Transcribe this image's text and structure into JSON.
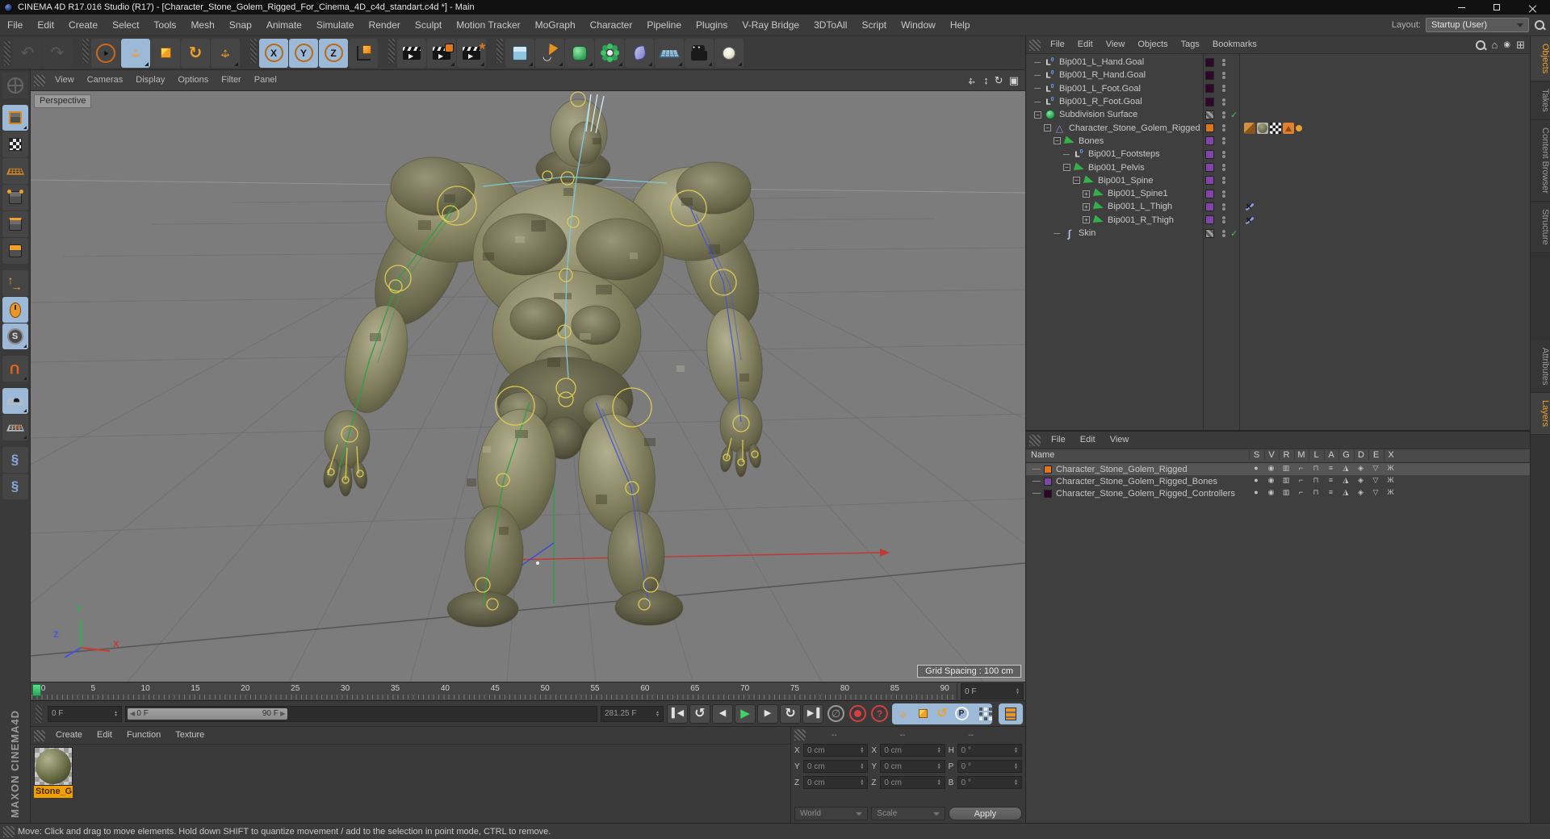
{
  "window": {
    "title": "CINEMA 4D R17.016 Studio (R17) - [Character_Stone_Golem_Rigged_For_Cinema_4D_c4d_standart.c4d *] - Main"
  },
  "menubar": [
    "File",
    "Edit",
    "Create",
    "Select",
    "Tools",
    "Mesh",
    "Snap",
    "Animate",
    "Simulate",
    "Render",
    "Sculpt",
    "Motion Tracker",
    "MoGraph",
    "Character",
    "Pipeline",
    "Plugins",
    "V-Ray Bridge",
    "3DToAll",
    "Script",
    "Window",
    "Help"
  ],
  "layout": {
    "label": "Layout:",
    "value": "Startup (User)"
  },
  "toolbar": {
    "groups": [
      {
        "buttons": [
          {
            "name": "undo",
            "disabled": true
          },
          {
            "name": "redo",
            "disabled": true
          }
        ]
      },
      {
        "buttons": [
          {
            "name": "live-selection"
          },
          {
            "name": "move",
            "active": true,
            "flyout": true
          },
          {
            "name": "scale"
          },
          {
            "name": "rotate"
          },
          {
            "name": "last-tool-move",
            "flyout": true
          }
        ]
      },
      {
        "buttons": [
          {
            "name": "lock-x",
            "letter": "X",
            "active": true
          },
          {
            "name": "lock-y",
            "letter": "Y",
            "active": true
          },
          {
            "name": "lock-z",
            "letter": "Z",
            "active": true
          },
          {
            "name": "coordinate-system"
          }
        ]
      },
      {
        "buttons": [
          {
            "name": "render-view"
          },
          {
            "name": "render-picture-viewer",
            "flyout": true
          },
          {
            "name": "render-settings",
            "flyout": true
          }
        ]
      },
      {
        "buttons": [
          {
            "name": "add-cube",
            "flyout": true
          },
          {
            "name": "add-spline",
            "flyout": true
          },
          {
            "name": "add-subdivision-surface",
            "flyout": true
          },
          {
            "name": "add-mograph",
            "flyout": true
          },
          {
            "name": "add-deformer",
            "flyout": true
          },
          {
            "name": "add-environment",
            "flyout": true
          },
          {
            "name": "add-camera",
            "flyout": true
          },
          {
            "name": "add-light",
            "flyout": true
          }
        ]
      }
    ]
  },
  "left_palette": [
    {
      "name": "make-editable",
      "disabled": true
    },
    {
      "name": "model-mode",
      "active": true,
      "flyout": true
    },
    {
      "name": "texture-mode"
    },
    {
      "name": "workplane-mode"
    },
    {
      "name": "points-mode"
    },
    {
      "name": "edges-mode"
    },
    {
      "name": "polygons-mode"
    },
    {
      "name": "enable-axis"
    },
    {
      "name": "viewport-mouse",
      "active": true
    },
    {
      "name": "viewport-solo",
      "active": true,
      "flyout": true
    },
    {
      "name": "enable-snap",
      "flyout": true
    },
    {
      "name": "workplane-lock",
      "active": true,
      "flyout": true
    },
    {
      "name": "workplane-interactive",
      "flyout": true
    },
    {
      "name": "script-python-1"
    },
    {
      "name": "script-python-2"
    }
  ],
  "viewport": {
    "menu": [
      "View",
      "Cameras",
      "Display",
      "Options",
      "Filter",
      "Panel"
    ],
    "view_label": "Perspective",
    "grid_spacing": "Grid Spacing : 100 cm",
    "axis_labels": {
      "x": "X",
      "y": "Y",
      "z": "Z"
    }
  },
  "object_manager": {
    "menu": [
      "File",
      "Edit",
      "View",
      "Objects",
      "Tags",
      "Bookmarks"
    ],
    "items": [
      {
        "label": "Bip001_L_Hand.Goal",
        "icon": "null-object-icon",
        "indent": 0,
        "expand": "none",
        "chip": "#30062b",
        "dots": true
      },
      {
        "label": "Bip001_R_Hand.Goal",
        "icon": "null-object-icon",
        "indent": 0,
        "expand": "none",
        "chip": "#30062b",
        "dots": true
      },
      {
        "label": "Bip001_L_Foot.Goal",
        "icon": "null-object-icon",
        "indent": 0,
        "expand": "none",
        "chip": "#30062b",
        "dots": true
      },
      {
        "label": "Bip001_R_Foot.Goal",
        "icon": "null-object-icon",
        "indent": 0,
        "expand": "none",
        "chip": "#30062b",
        "dots": true
      },
      {
        "label": "Subdivision Surface",
        "icon": "subdivision-surface-icon",
        "indent": 0,
        "expand": "minus",
        "chip": "striped",
        "dots": true,
        "check": true
      },
      {
        "label": "Character_Stone_Golem_Rigged",
        "icon": "polygon-object-icon",
        "indent": 1,
        "expand": "minus",
        "chip": "#e0761c",
        "dots": true,
        "tags": [
          "weight-tag",
          "texture-tag",
          "uvw-tag",
          "phong-tag",
          "display-dot-tag"
        ]
      },
      {
        "label": "Bones",
        "icon": "joint-icon",
        "indent": 2,
        "expand": "minus",
        "chip": "#8045aa",
        "dots": true
      },
      {
        "label": "Bip001_Footsteps",
        "icon": "null-object-icon",
        "indent": 3,
        "expand": "none",
        "chip": "#8045aa",
        "dots": true
      },
      {
        "label": "Bip001_Pelvis",
        "icon": "joint-icon",
        "indent": 3,
        "expand": "minus",
        "chip": "#8045aa",
        "dots": true
      },
      {
        "label": "Bip001_Spine",
        "icon": "joint-icon",
        "indent": 4,
        "expand": "minus",
        "chip": "#8045aa",
        "dots": true
      },
      {
        "label": "Bip001_Spine1",
        "icon": "joint-icon",
        "indent": 5,
        "expand": "plus",
        "chip": "#8045aa",
        "dots": true
      },
      {
        "label": "Bip001_L_Thigh",
        "icon": "joint-icon",
        "indent": 5,
        "expand": "plus",
        "chip": "#8045aa",
        "dots": true,
        "tags": [
          "ik-tag"
        ]
      },
      {
        "label": "Bip001_R_Thigh",
        "icon": "joint-icon",
        "indent": 5,
        "expand": "plus",
        "chip": "#8045aa",
        "dots": true,
        "tags": [
          "ik-tag"
        ]
      },
      {
        "label": "Skin",
        "icon": "skin-icon",
        "indent": 2,
        "expand": "none",
        "chip": "striped",
        "dots": true,
        "check": true
      }
    ]
  },
  "right_tabs": {
    "top": [
      {
        "label": "Objects",
        "active": true
      },
      {
        "label": "Takes",
        "active": false
      },
      {
        "label": "Content Browser",
        "active": false
      },
      {
        "label": "Structure",
        "active": false
      }
    ],
    "bottom": [
      {
        "label": "Attributes",
        "active": false
      },
      {
        "label": "Layers",
        "active": true
      }
    ]
  },
  "layers_panel": {
    "menu": [
      "File",
      "Edit",
      "View"
    ],
    "name_column": "Name",
    "columns": [
      "S",
      "V",
      "R",
      "M",
      "L",
      "A",
      "G",
      "D",
      "E",
      "X"
    ],
    "rows": [
      {
        "name": "Character_Stone_Golem_Rigged",
        "color": "#e0761c",
        "selected": true
      },
      {
        "name": "Character_Stone_Golem_Rigged_Bones",
        "color": "#8045aa",
        "selected": false
      },
      {
        "name": "Character_Stone_Golem_Rigged_Controllers",
        "color": "#30062b",
        "selected": false
      }
    ]
  },
  "timeline": {
    "ticks": [
      "0",
      "5",
      "10",
      "15",
      "20",
      "25",
      "30",
      "35",
      "40",
      "45",
      "50",
      "55",
      "60",
      "65",
      "70",
      "75",
      "80",
      "85",
      "90"
    ],
    "frame_field": "0 F",
    "current_frame": "0 F",
    "range_start": "0 F",
    "range_end": "90 F",
    "total_frames": "281.25 F"
  },
  "materials": {
    "menu": [
      "Create",
      "Edit",
      "Function",
      "Texture"
    ],
    "items": [
      {
        "name": "Stone_G"
      }
    ]
  },
  "coordinates": {
    "headers": [
      "--",
      "--",
      "--"
    ],
    "columns": [
      {
        "rows": [
          {
            "label": "X",
            "value": "0 cm"
          },
          {
            "label": "Y",
            "value": "0 cm"
          },
          {
            "label": "Z",
            "value": "0 cm"
          }
        ],
        "footer": {
          "type": "dropdown",
          "value": "World"
        }
      },
      {
        "rows": [
          {
            "label": "X",
            "value": "0 cm"
          },
          {
            "label": "Y",
            "value": "0 cm"
          },
          {
            "label": "Z",
            "value": "0 cm"
          }
        ],
        "footer": {
          "type": "dropdown",
          "value": "Scale"
        }
      },
      {
        "rows": [
          {
            "label": "H",
            "value": "0 °"
          },
          {
            "label": "P",
            "value": "0 °"
          },
          {
            "label": "B",
            "value": "0 °"
          }
        ],
        "footer": {
          "type": "button",
          "value": "Apply"
        }
      }
    ]
  },
  "status_bar": "Move: Click and drag to move elements. Hold down SHIFT to quantize movement / add to the selection in point mode, CTRL to remove.",
  "branding": "MAXON CINEMA4D",
  "colors": {
    "accent_orange": "#f0a028",
    "highlight_blue": "#9cb9d8",
    "viewport_gray": "#7c7c7c",
    "panel_bg": "#3b3b3b"
  }
}
